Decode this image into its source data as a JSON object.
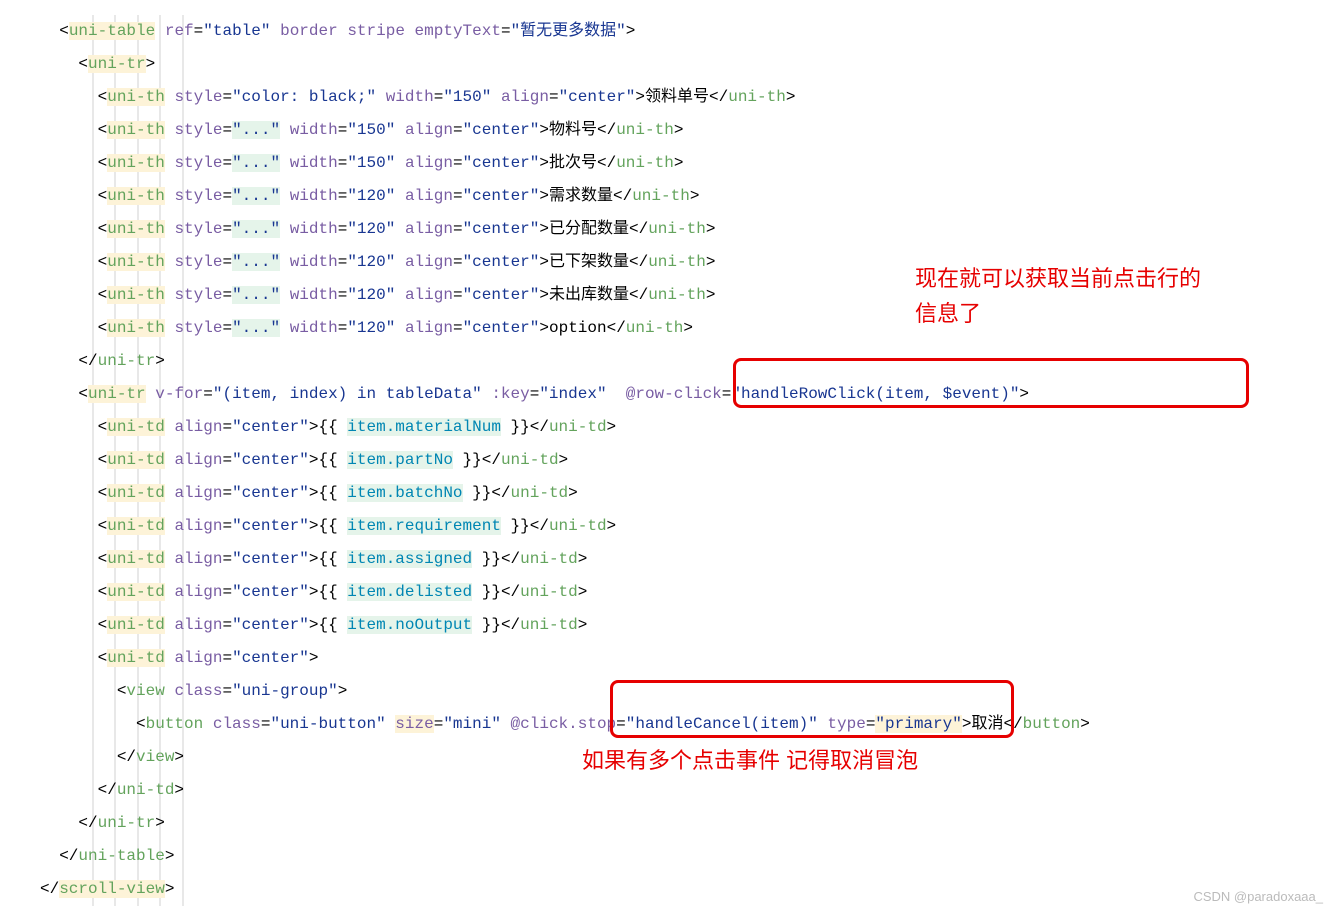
{
  "code": {
    "l1": {
      "tag": "uni-table",
      "ref": "ref",
      "refv": "\"table\"",
      "border": "border",
      "stripe": "stripe",
      "empty": "emptyText",
      "emptyv": "\"暂无更多数据\""
    },
    "l2": {
      "tag": "uni-tr"
    },
    "th": [
      {
        "tag": "uni-th",
        "style": "style",
        "stylev": "\"color: black;\"",
        "width": "width",
        "widthv": "\"150\"",
        "align": "align",
        "alignv": "\"center\"",
        "txt": "领料单号",
        "close": "uni-th"
      },
      {
        "tag": "uni-th",
        "style": "style",
        "stylev": "\"...\"",
        "width": "width",
        "widthv": "\"150\"",
        "align": "align",
        "alignv": "\"center\"",
        "txt": "物料号",
        "close": "uni-th"
      },
      {
        "tag": "uni-th",
        "style": "style",
        "stylev": "\"...\"",
        "width": "width",
        "widthv": "\"150\"",
        "align": "align",
        "alignv": "\"center\"",
        "txt": "批次号",
        "close": "uni-th"
      },
      {
        "tag": "uni-th",
        "style": "style",
        "stylev": "\"...\"",
        "width": "width",
        "widthv": "\"120\"",
        "align": "align",
        "alignv": "\"center\"",
        "txt": "需求数量",
        "close": "uni-th"
      },
      {
        "tag": "uni-th",
        "style": "style",
        "stylev": "\"...\"",
        "width": "width",
        "widthv": "\"120\"",
        "align": "align",
        "alignv": "\"center\"",
        "txt": "已分配数量",
        "close": "uni-th"
      },
      {
        "tag": "uni-th",
        "style": "style",
        "stylev": "\"...\"",
        "width": "width",
        "widthv": "\"120\"",
        "align": "align",
        "alignv": "\"center\"",
        "txt": "已下架数量",
        "close": "uni-th"
      },
      {
        "tag": "uni-th",
        "style": "style",
        "stylev": "\"...\"",
        "width": "width",
        "widthv": "\"120\"",
        "align": "align",
        "alignv": "\"center\"",
        "txt": "未出库数量",
        "close": "uni-th"
      },
      {
        "tag": "uni-th",
        "style": "style",
        "stylev": "\"...\"",
        "width": "width",
        "widthv": "\"120\"",
        "align": "align",
        "alignv": "\"center\"",
        "txt": "option",
        "close": "uni-th"
      }
    ],
    "trclose": "uni-tr",
    "tr2": {
      "tag": "uni-tr",
      "vfor": "v-for",
      "vforv": "\"(item, index) in tableData\"",
      "key": ":key",
      "keyv": "\"index\"",
      "rc": "@row-click",
      "rcv": "\"handleRowClick(item, $event)\""
    },
    "td": [
      {
        "tag": "uni-td",
        "align": "align",
        "alignv": "\"center\"",
        "open": "{{ ",
        "expr": "item.materialNum",
        "close": " }}",
        "ctag": "uni-td"
      },
      {
        "tag": "uni-td",
        "align": "align",
        "alignv": "\"center\"",
        "open": "{{ ",
        "expr": "item.partNo",
        "close": " }}",
        "ctag": "uni-td"
      },
      {
        "tag": "uni-td",
        "align": "align",
        "alignv": "\"center\"",
        "open": "{{ ",
        "expr": "item.batchNo",
        "close": " }}",
        "ctag": "uni-td"
      },
      {
        "tag": "uni-td",
        "align": "align",
        "alignv": "\"center\"",
        "open": "{{ ",
        "expr": "item.requirement",
        "close": " }}",
        "ctag": "uni-td"
      },
      {
        "tag": "uni-td",
        "align": "align",
        "alignv": "\"center\"",
        "open": "{{ ",
        "expr": "item.assigned",
        "close": " }}",
        "ctag": "uni-td"
      },
      {
        "tag": "uni-td",
        "align": "align",
        "alignv": "\"center\"",
        "open": "{{ ",
        "expr": "item.delisted",
        "close": " }}",
        "ctag": "uni-td"
      },
      {
        "tag": "uni-td",
        "align": "align",
        "alignv": "\"center\"",
        "open": "{{ ",
        "expr": "item.noOutput",
        "close": " }}",
        "ctag": "uni-td"
      }
    ],
    "td8": {
      "tag": "uni-td",
      "align": "align",
      "alignv": "\"center\""
    },
    "view": {
      "tag": "view",
      "class": "class",
      "classv": "\"uni-group\""
    },
    "btn": {
      "tag": "button",
      "class": "class",
      "classv": "\"uni-button\"",
      "size": "size",
      "sizev": "\"mini\"",
      "click": "@click.stop",
      "clickv": "\"handleCancel(item)\"",
      "type": "type",
      "typev": "\"primary\"",
      "txt": "取消",
      "close": "button"
    },
    "viewclose": "view",
    "tdclose": "uni-td",
    "tr2close": "uni-tr",
    "tableclose": "uni-table",
    "scrollclose": "scroll-view"
  },
  "annot1": "现在就可以获取当前点击行的",
  "annot1b": "信息了",
  "annot2": "如果有多个点击事件 记得取消冒泡",
  "watermark": "CSDN @paradoxaaa_"
}
